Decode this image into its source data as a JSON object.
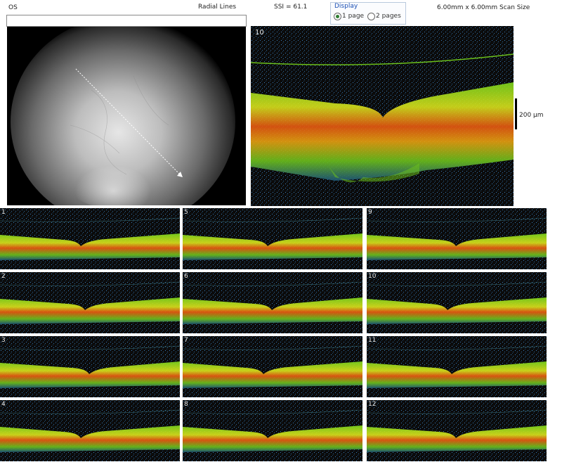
{
  "header": {
    "eye": "OS",
    "protocol": "Radial Lines",
    "ssi": "SSI = 61.1",
    "scan_size": "6.00mm x 6.00mm Scan Size"
  },
  "display": {
    "title": "Display",
    "options": [
      "1 page",
      "2 pages"
    ],
    "selected": "1 page"
  },
  "main_scan": {
    "number": "10",
    "scale_label": "200 µm"
  },
  "thumbnails": [
    "1",
    "2",
    "3",
    "4",
    "5",
    "6",
    "7",
    "8",
    "9",
    "10",
    "11",
    "12"
  ],
  "colors": {
    "retina_orange": "#e85a10",
    "retina_green": "#7cd51c",
    "retina_yellow": "#d8e21c"
  }
}
